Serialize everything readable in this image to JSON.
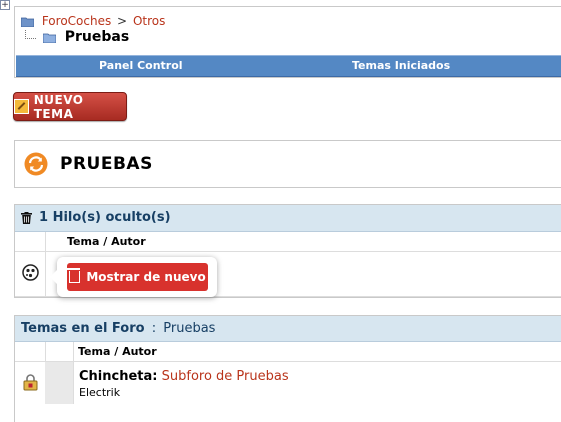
{
  "breadcrumb": {
    "root": "ForoCoches",
    "separator": ">",
    "parent": "Otros",
    "current": "Pruebas"
  },
  "navbar": {
    "items": [
      "Panel Control",
      "Temas Iniciados"
    ]
  },
  "new_topic_button": "NUEVO TEMA",
  "forum": {
    "title": "PRUEBAS"
  },
  "hidden_section": {
    "header": "1 Hilo(s) oculto(s)",
    "column_header": "Tema / Autor",
    "show_again_button": "Mostrar de nuevo"
  },
  "topics_section": {
    "header_label": "Temas en el Foro",
    "header_separator": ":",
    "header_forum": "Pruebas",
    "column_header": "Tema / Autor",
    "rows": [
      {
        "prefix": "Chincheta:",
        "title": "Subforo de Pruebas",
        "author": "Electrik"
      }
    ]
  },
  "colors": {
    "link": "#b9341b",
    "navbar": "#5488c4",
    "section_header": "#d7e6f0",
    "danger": "#d8322d"
  }
}
